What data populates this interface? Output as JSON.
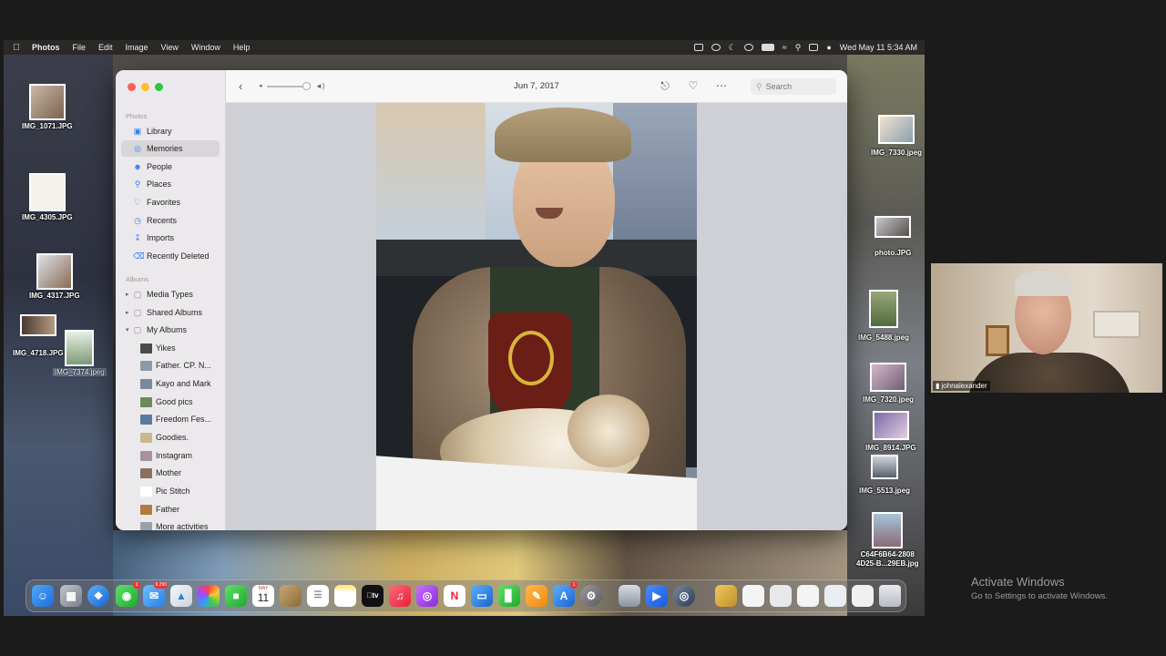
{
  "menubar": {
    "apple_icon": "apple-logo",
    "app_name": "Photos",
    "menus": [
      "File",
      "Edit",
      "Image",
      "View",
      "Window",
      "Help"
    ],
    "datetime": "Wed May 11  5:34 AM"
  },
  "desktop_icons_left": [
    {
      "label": "IMG_1071.JPG"
    },
    {
      "label": "IMG_4305.JPG"
    },
    {
      "label": "IMG_4317.JPG"
    },
    {
      "label": "IMG_4718.JPG"
    },
    {
      "label": "IMG_7374.jpeg"
    }
  ],
  "desktop_icons_right": [
    {
      "label": "IMG_7330.jpeg"
    },
    {
      "label": "photo.JPG"
    },
    {
      "label": "IMG_5488.jpeg"
    },
    {
      "label": "IMG_7320.jpeg"
    },
    {
      "label": "IMG_8914.JPG"
    },
    {
      "label": "IMG_5513.jpeg"
    },
    {
      "label": "C64F6B64-2808\n4D25-B...29EB.jpg"
    }
  ],
  "window": {
    "toolbar": {
      "date": "Jun 7, 2017",
      "search_placeholder": "Search",
      "icons": [
        "back-icon",
        "zoom-slider",
        "share-icon",
        "heart-icon",
        "more-icon",
        "search-icon"
      ]
    },
    "sidebar": {
      "section_photos": "Photos",
      "library": "Library",
      "memories": "Memories",
      "people": "People",
      "places": "Places",
      "favorites": "Favorites",
      "recents": "Recents",
      "imports": "Imports",
      "recently_deleted": "Recently Deleted",
      "section_albums": "Albums",
      "media_types": "Media Types",
      "shared_albums": "Shared Albums",
      "my_albums": "My Albums",
      "albums": [
        "Yikes",
        "Father. CP. N...",
        "Kayo and Mark",
        "Good pics",
        "Freedom Fes...",
        "Goodies.",
        "Instagram",
        "Mother",
        "Pic Stitch",
        "Father",
        "More activities"
      ]
    }
  },
  "dock": {
    "calendar_month": "MAY",
    "calendar_day": "11",
    "badges": {
      "messages": "1",
      "mail": "9,290",
      "app_store": "1"
    }
  },
  "video": {
    "participant_name": "johnalexander"
  },
  "activation": {
    "title": "Activate Windows",
    "subtitle": "Go to Settings to activate Windows."
  }
}
